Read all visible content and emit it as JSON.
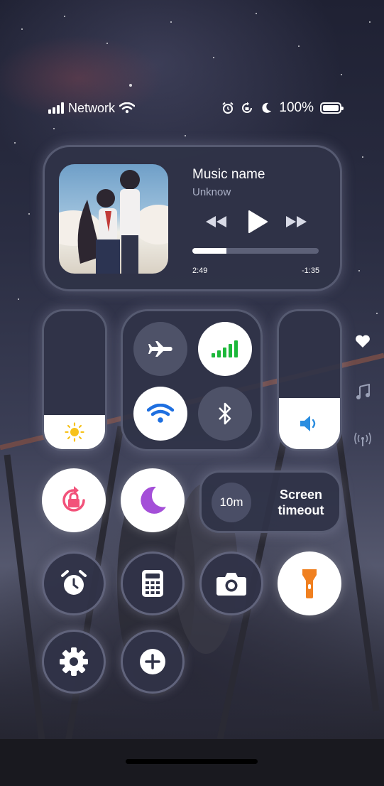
{
  "status_bar": {
    "network_label": "Network",
    "battery_label": "100%",
    "battery_level": 1.0,
    "icons": [
      "signal-bars-icon",
      "wifi-icon",
      "alarm-icon",
      "rotation-lock-icon",
      "moon-icon",
      "battery-icon"
    ]
  },
  "media": {
    "title": "Music name",
    "artist": "Unknow",
    "elapsed": "2:49",
    "remaining": "-1:35",
    "progress": 0.27,
    "controls": [
      "rewind-icon",
      "play-icon",
      "fast-forward-icon"
    ]
  },
  "brightness": {
    "level": 0.25,
    "icon": "sun-icon"
  },
  "volume": {
    "level": 0.37,
    "icon": "speaker-icon"
  },
  "connectivity": {
    "airplane": {
      "icon": "airplane-icon",
      "active": false
    },
    "cellular": {
      "icon": "cellular-data-icon",
      "active": true
    },
    "wifi": {
      "icon": "wifi-icon",
      "active": true
    },
    "bluetooth": {
      "icon": "bluetooth-icon",
      "active": false
    }
  },
  "screen_timeout": {
    "value": "10m",
    "label": "Screen timeout"
  },
  "toggles": [
    "rotation-lock-icon",
    "moon-icon",
    "alarm-clock-icon",
    "calculator-icon",
    "camera-icon",
    "flashlight-icon",
    "settings-gear-icon",
    "add-icon"
  ],
  "side_icons": [
    "heart-icon",
    "music-note-icon",
    "radio-signal-icon"
  ],
  "colors": {
    "accent_green": "#1db83a",
    "wifi_blue": "#1e6fe0",
    "moon_purple": "#a44fd8",
    "lock_pink": "#f2527a",
    "flashlight_orange": "#f08020"
  }
}
